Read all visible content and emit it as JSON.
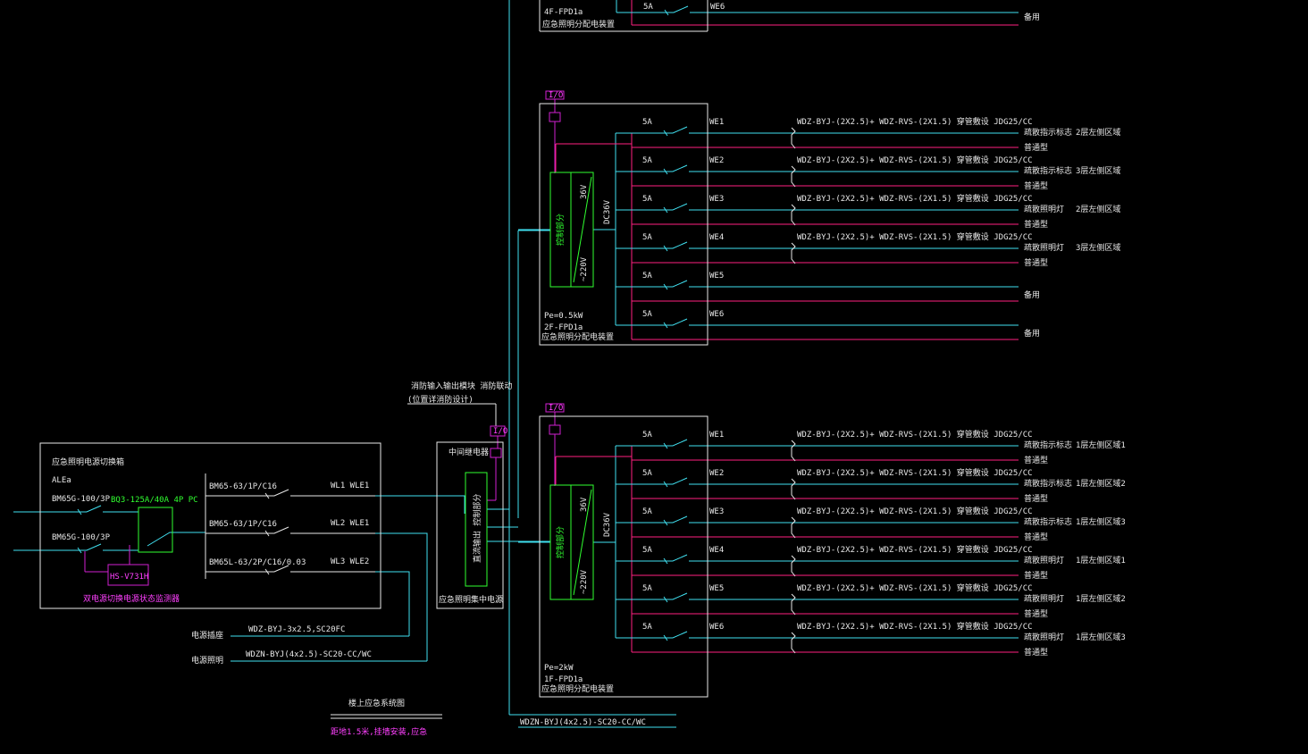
{
  "colors": {
    "background": "#000000",
    "cyan": "#40e0f0",
    "pink": "#ff2080",
    "magenta": "#d020d0",
    "white": "#e8e8e8",
    "green": "#30ff30"
  },
  "top_panel": {
    "row_breaker": "5A",
    "row_circuit": "WE6",
    "row_dest": "备用",
    "panel_code": "4F-FPD1a",
    "panel_desc": "应急照明分配电装置"
  },
  "panel_2f": {
    "io_tag": "I/O",
    "voltage_top": "36V",
    "voltage_bottom": "~220V",
    "ctrl_label": "控制部分",
    "dc_label": "DC36V",
    "pe": "Pe=0.5kW",
    "code": "2F-FPD1a",
    "desc": "应急照明分配电装置",
    "rows": [
      {
        "breaker": "5A",
        "circuit": "WE1",
        "cable": "WDZ-BYJ-(2X2.5)+ WDZ-RVS-(2X1.5) 穿管敷设 JDG25/CC",
        "dest1": "疏散指示标志",
        "dest2": "普通型",
        "area": "2层左侧区域"
      },
      {
        "breaker": "5A",
        "circuit": "WE2",
        "cable": "WDZ-BYJ-(2X2.5)+ WDZ-RVS-(2X1.5) 穿管敷设 JDG25/CC",
        "dest1": "疏散指示标志",
        "dest2": "普通型",
        "area": "3层左侧区域"
      },
      {
        "breaker": "5A",
        "circuit": "WE3",
        "cable": "WDZ-BYJ-(2X2.5)+ WDZ-RVS-(2X1.5) 穿管敷设 JDG25/CC",
        "dest1": "疏散照明灯",
        "dest2": "普通型",
        "area": "2层左侧区域"
      },
      {
        "breaker": "5A",
        "circuit": "WE4",
        "cable": "WDZ-BYJ-(2X2.5)+ WDZ-RVS-(2X1.5) 穿管敷设 JDG25/CC",
        "dest1": "疏散照明灯",
        "dest2": "普通型",
        "area": "3层左侧区域"
      },
      {
        "breaker": "5A",
        "circuit": "WE5",
        "cable": "",
        "dest1": "备用",
        "dest2": "",
        "area": ""
      },
      {
        "breaker": "5A",
        "circuit": "WE6",
        "cable": "",
        "dest1": "备用",
        "dest2": "",
        "area": ""
      }
    ]
  },
  "panel_1f": {
    "io_tag": "I/O",
    "voltage_top": "36V",
    "voltage_bottom": "~220V",
    "ctrl_label": "控制部分",
    "dc_label": "DC36V",
    "pe": "Pe=2kW",
    "code": "1F-FPD1a",
    "desc": "应急照明分配电装置",
    "rows": [
      {
        "breaker": "5A",
        "circuit": "WE1",
        "cable": "WDZ-BYJ-(2X2.5)+ WDZ-RVS-(2X1.5) 穿管敷设 JDG25/CC",
        "dest1": "疏散指示标志",
        "dest2": "普通型",
        "area": "1层左侧区域1"
      },
      {
        "breaker": "5A",
        "circuit": "WE2",
        "cable": "WDZ-BYJ-(2X2.5)+ WDZ-RVS-(2X1.5) 穿管敷设 JDG25/CC",
        "dest1": "疏散指示标志",
        "dest2": "普通型",
        "area": "1层左侧区域2"
      },
      {
        "breaker": "5A",
        "circuit": "WE3",
        "cable": "WDZ-BYJ-(2X2.5)+ WDZ-RVS-(2X1.5) 穿管敷设 JDG25/CC",
        "dest1": "疏散指示标志",
        "dest2": "普通型",
        "area": "1层左侧区域3"
      },
      {
        "breaker": "5A",
        "circuit": "WE4",
        "cable": "WDZ-BYJ-(2X2.5)+ WDZ-RVS-(2X1.5) 穿管敷设 JDG25/CC",
        "dest1": "疏散照明灯",
        "dest2": "普通型",
        "area": "1层左侧区域1"
      },
      {
        "breaker": "5A",
        "circuit": "WE5",
        "cable": "WDZ-BYJ-(2X2.5)+ WDZ-RVS-(2X1.5) 穿管敷设 JDG25/CC",
        "dest1": "疏散照明灯",
        "dest2": "普通型",
        "area": "1层左侧区域2"
      },
      {
        "breaker": "5A",
        "circuit": "WE6",
        "cable": "WDZ-BYJ-(2X2.5)+ WDZ-RVS-(2X1.5) 穿管敷设 JDG25/CC",
        "dest1": "疏散照明灯",
        "dest2": "普通型",
        "area": "1层左侧区域3"
      }
    ]
  },
  "main_box": {
    "title": "应急照明电源切换箱",
    "code": "ALEa",
    "in_breaker_1": "BM65G-100/3P",
    "in_breaker_2": "BM65G-100/3P",
    "ats": "BQ3-125A/40A 4P PC",
    "ats_ctrl": "HS-V731H",
    "ats_note": "双电源切换电源状态监测器",
    "feeders": [
      {
        "breaker": "BM65-63/1P/C16",
        "wl": "WL1",
        "wle": "WLE1"
      },
      {
        "breaker": "BM65-63/1P/C16",
        "wl": "WL2",
        "wle": "WLE1"
      },
      {
        "breaker": "BM65L-63/2P/C16/0.03",
        "wl": "WL3",
        "wle": "WLE2"
      }
    ]
  },
  "central": {
    "note_line1": "消防输入输出模块  消防联动",
    "note_line2": "(位置详消防设计)",
    "io_tag": "I/O",
    "relay": "中间继电器",
    "ctrl": "控制部分",
    "supply": "直流输出",
    "desc": "应急照明集中电源"
  },
  "cables": {
    "line1_label": "电源插座",
    "line1_cable": "WDZ-BYJ-3x2.5,SC20FC",
    "line2_label": "电源照明",
    "line2_cable": "WDZN-BYJ(4x2.5)-SC20-CC/WC",
    "bottom_cable": "WDZN-BYJ(4x2.5)-SC20-CC/WC"
  },
  "footer": {
    "title": "楼上应急系统图",
    "note": "距地1.5米,挂墙安装,应急"
  }
}
